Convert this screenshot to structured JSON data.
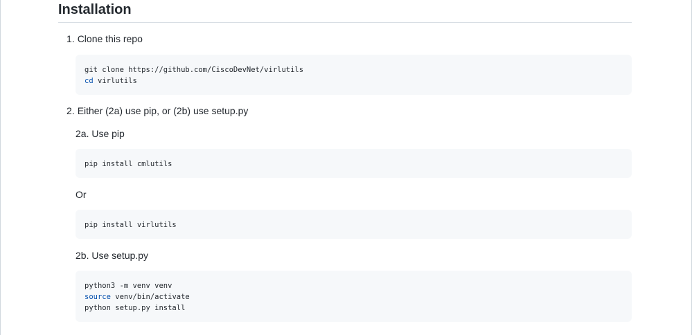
{
  "section": {
    "title": "Installation"
  },
  "steps": [
    {
      "number": "1.",
      "text": "Clone this repo"
    },
    {
      "number": "2.",
      "text": "Either (2a) use pip, or (2b) use setup.py"
    }
  ],
  "substeps": {
    "a": "2a. Use pip",
    "or": "Or",
    "b": "2b. Use setup.py"
  },
  "code": {
    "clone": {
      "line1": "git clone https://github.com/CiscoDevNet/virlutils",
      "line2_kw": "cd",
      "line2_rest": " virlutils"
    },
    "pip_cml": "pip install cmlutils",
    "pip_virl": "pip install virlutils",
    "setup": {
      "line1": "python3 -m venv venv",
      "line2_kw": "source",
      "line2_rest": " venv/bin/activate",
      "line3": "python setup.py install"
    }
  },
  "colors": {
    "code_bg": "#f6f8fa",
    "keyword": "#0550ae",
    "text": "#24292f"
  }
}
